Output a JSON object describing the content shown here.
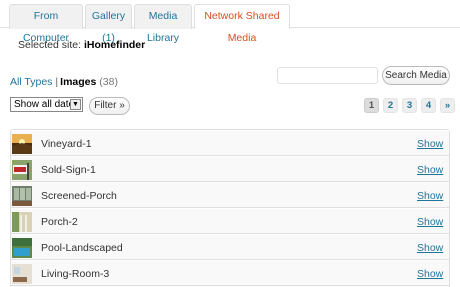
{
  "tabs": [
    {
      "label": "From Computer"
    },
    {
      "label": "Gallery (1)"
    },
    {
      "label": "Media Library"
    },
    {
      "label": "Network Shared Media"
    }
  ],
  "site": {
    "prefix": "Selected site:",
    "name": "iHomefinder"
  },
  "filters": {
    "all_types": "All Types",
    "separator": "|",
    "images": "Images",
    "count": "(38)"
  },
  "search": {
    "value": "",
    "button_label": "Search Media"
  },
  "date_filter": {
    "selected": "Show all dates"
  },
  "filter_button": {
    "label": "Filter »"
  },
  "pagination": {
    "pages": [
      "1",
      "2",
      "3",
      "4"
    ],
    "next": "»",
    "current": "1"
  },
  "media_items": [
    {
      "title": "Vineyard-1",
      "action": "Show"
    },
    {
      "title": "Sold-Sign-1",
      "action": "Show"
    },
    {
      "title": "Screened-Porch",
      "action": "Show"
    },
    {
      "title": "Porch-2",
      "action": "Show"
    },
    {
      "title": "Pool-Landscaped",
      "action": "Show"
    },
    {
      "title": "Living-Room-3",
      "action": "Show"
    }
  ],
  "colors": {
    "link": "#21759b",
    "active_tab": "#d54e21"
  }
}
